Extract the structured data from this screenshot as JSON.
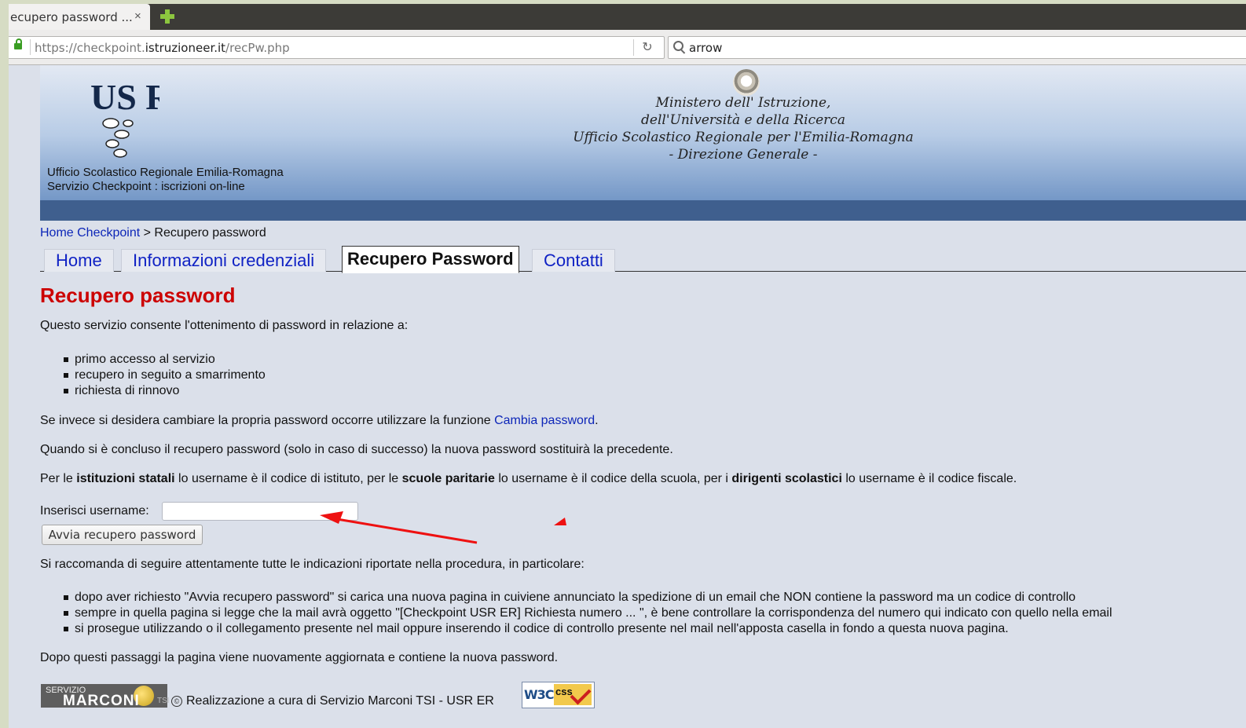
{
  "browser": {
    "tab_title": "ecupero password ...",
    "tab_close": "×",
    "url_prefix": "https://checkpoint.",
    "url_domain": "istruzioneer.it",
    "url_path": "/recPw.php",
    "reload_icon": "↻",
    "search_value": "arrow"
  },
  "header": {
    "logo_text": "US R",
    "site_line1": "Ufficio Scolastico Regionale Emilia-Romagna",
    "site_line2": "Servizio Checkpoint : iscrizioni on-line",
    "ministry_line1": "Ministero dell' Istruzione,",
    "ministry_line2": "dell'Università e della Ricerca",
    "ministry_line3": "Ufficio Scolastico Regionale per l'Emilia-Romagna",
    "ministry_line4": "- Direzione Generale -"
  },
  "breadcrumb": {
    "home": "Home Checkpoint",
    "current": "> Recupero password"
  },
  "menu": [
    {
      "label": "Home"
    },
    {
      "label": "Informazioni credenziali"
    },
    {
      "label": "Recupero Password"
    },
    {
      "label": "Contatti"
    }
  ],
  "content": {
    "title": "Recupero password",
    "intro": "Questo servizio consente l'ottenimento di password in relazione a:",
    "reasons": [
      "primo accesso al servizio",
      "recupero in seguito a smarrimento",
      "richiesta di rinnovo"
    ],
    "change_text": "Se invece si desidera cambiare la propria password occorre utilizzare la funzione",
    "change_link": "Cambia password",
    "change_end": ".",
    "note": "Quando si è concluso il recupero password (solo in caso di successo) la nuova password sostituirà la precedente.",
    "rule_1": "Per le ",
    "rule_b1": "istituzioni statali",
    "rule_2": " lo username è il codice di istituto, per le ",
    "rule_b2": "scuole paritarie",
    "rule_3": " lo username è il codice della scuola, per i ",
    "rule_b3": "dirigenti scolastici",
    "rule_4": " lo username è il codice fiscale.",
    "username_label": "Inserisci username:",
    "username_value": "",
    "submit_label": "Avvia recupero password",
    "recommend": "Si raccomanda di seguire attentamente tutte le indicazioni riportate nella procedura, in particolare:",
    "steps": [
      "dopo aver richiesto \"Avvia recupero password\" si carica una nuova pagina in cuiviene annunciato la spedizione di un email che NON contiene la password ma un codice di controllo",
      "sempre in quella pagina si legge che la mail avrà oggetto \"[Checkpoint USR ER] Richiesta numero ... \", è bene controllare la corrispondenza del numero qui indicato con quello nella email",
      "si prosegue utilizzando o il collegamento presente nel mail oppure inserendo il codice di controllo presente nel mail nell'apposta casella in fondo a questa nuova pagina."
    ],
    "after": "Dopo questi passaggi la pagina viene nuovamente aggiornata e contiene la nuova password."
  },
  "footer": {
    "logo_small": "SERVIZIO",
    "logo_big": "MARCONI",
    "logo_tsi": "TSI",
    "cc_symbol": "©",
    "credit": "Realizzazione a cura di Servizio Marconi TSI - USR ER",
    "w3c": "W3C",
    "css": "css"
  },
  "colors": {
    "title_red": "#cc0000",
    "link_blue": "#0d26b8",
    "annotation_arrow": "#ee1111"
  }
}
